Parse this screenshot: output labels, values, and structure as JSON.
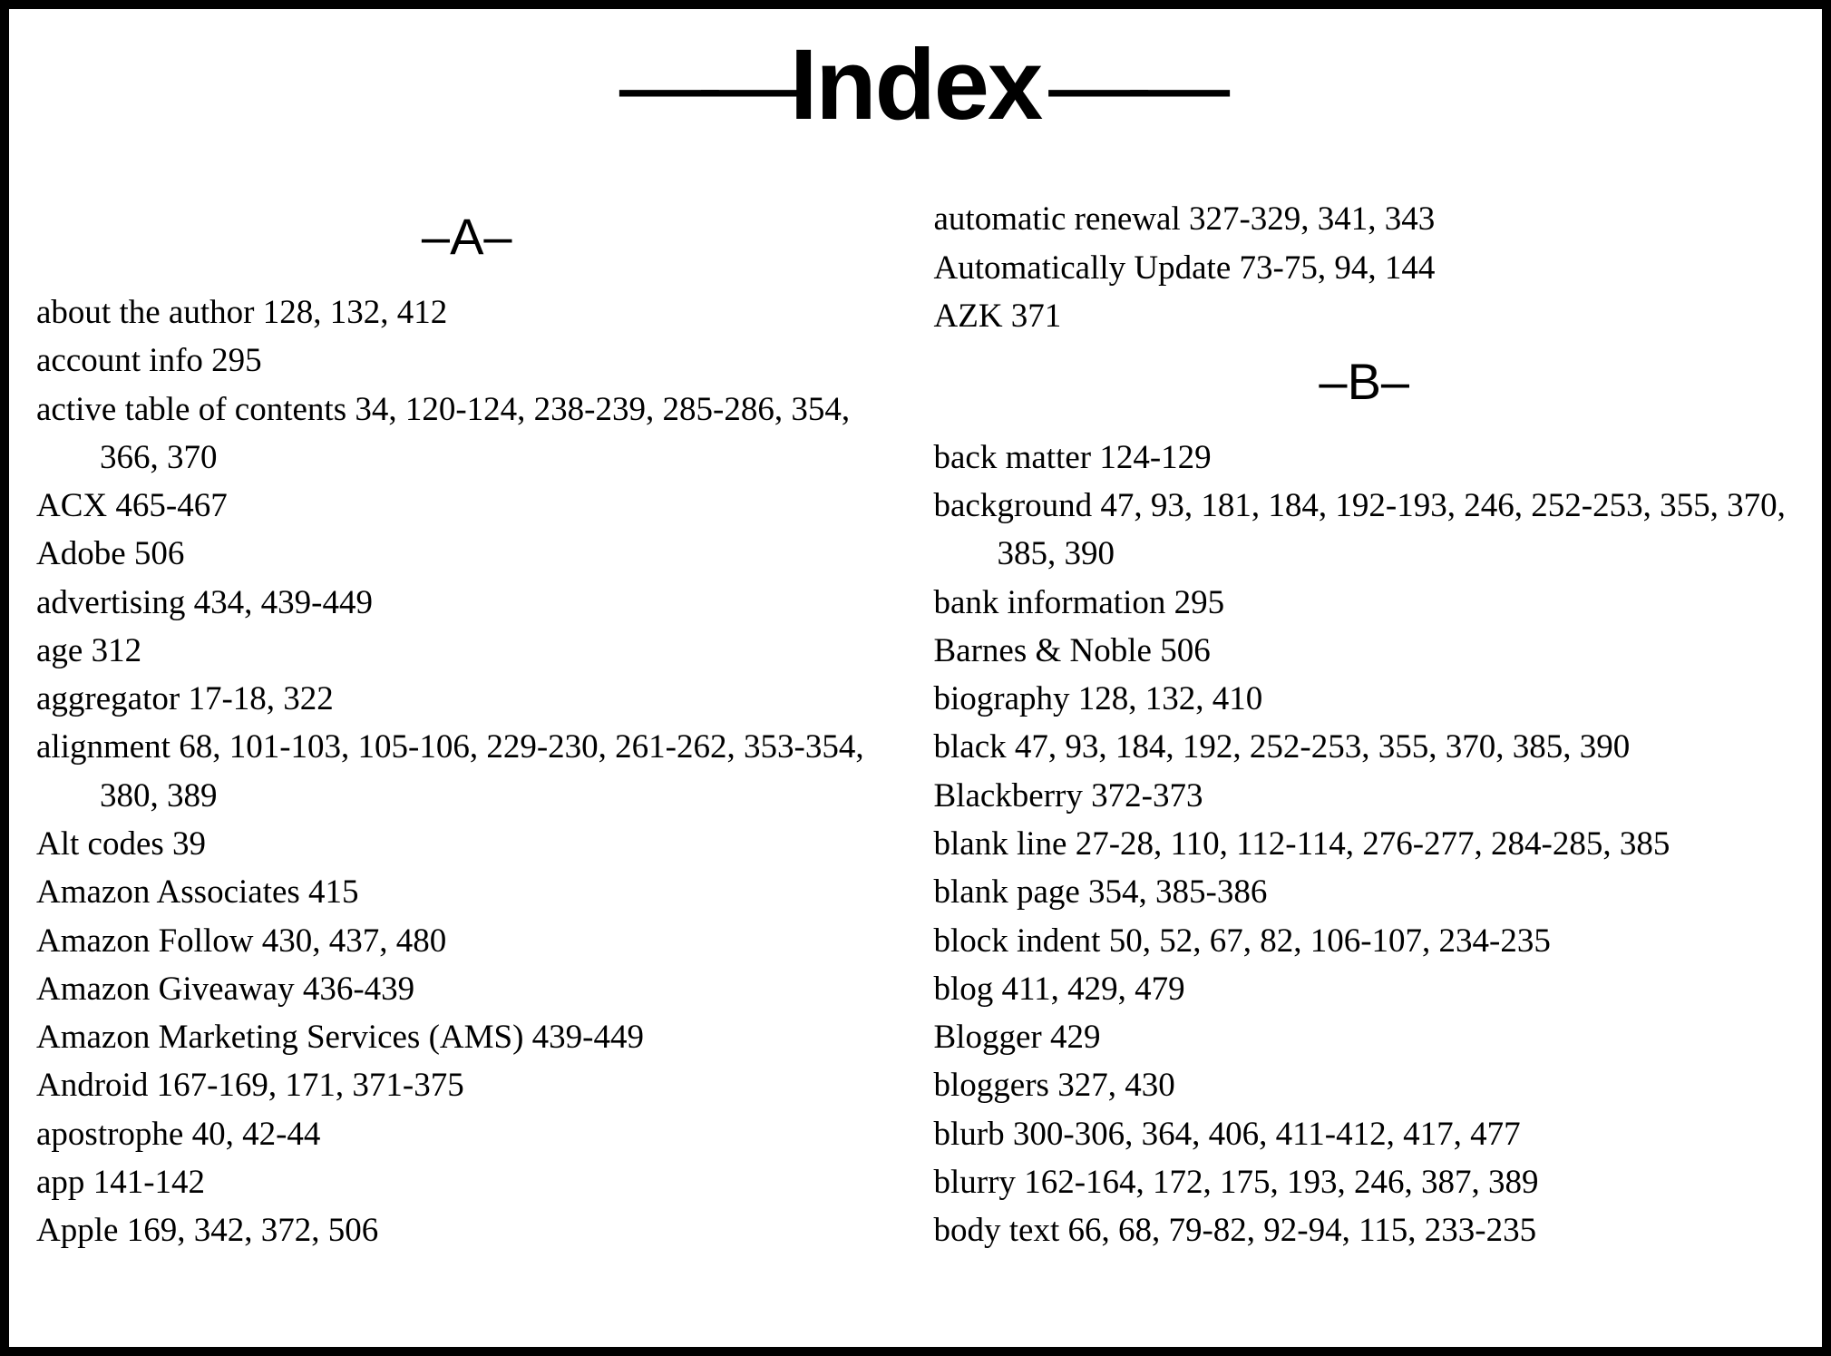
{
  "title": "Index",
  "sections": [
    {
      "letter": "A",
      "column": 0,
      "position": 0
    },
    {
      "letter": "B",
      "column": 1,
      "position": 3
    }
  ],
  "columns": [
    [
      {
        "term": "about the author",
        "pages": "128, 132, 412"
      },
      {
        "term": "account info",
        "pages": "295"
      },
      {
        "term": "active table of contents",
        "pages": "34, 120-124, 238-239, 285-286, 354, 366, 370"
      },
      {
        "term": "ACX",
        "pages": "465-467"
      },
      {
        "term": "Adobe",
        "pages": "506"
      },
      {
        "term": "advertising",
        "pages": "434, 439-449"
      },
      {
        "term": "age",
        "pages": "312"
      },
      {
        "term": "aggregator",
        "pages": "17-18, 322"
      },
      {
        "term": "alignment",
        "pages": "68, 101-103, 105-106, 229-230, 261-262, 353-354, 380, 389"
      },
      {
        "term": "Alt codes",
        "pages": "39"
      },
      {
        "term": "Amazon Associates",
        "pages": "415"
      },
      {
        "term": "Amazon Follow",
        "pages": "430, 437, 480"
      },
      {
        "term": "Amazon Giveaway",
        "pages": "436-439"
      },
      {
        "term": "Amazon Marketing Services (AMS)",
        "pages": "439-449"
      },
      {
        "term": "Android",
        "pages": "167-169, 171, 371-375"
      },
      {
        "term": "apostrophe",
        "pages": "40, 42-44"
      },
      {
        "term": "app",
        "pages": "141-142"
      },
      {
        "term": "Apple",
        "pages": "169, 342, 372, 506"
      }
    ],
    [
      {
        "term": "automatic renewal",
        "pages": "327-329, 341, 343"
      },
      {
        "term": "Automatically Update",
        "pages": "73-75, 94, 144"
      },
      {
        "term": "AZK",
        "pages": "371"
      },
      {
        "term": "back matter",
        "pages": "124-129"
      },
      {
        "term": "background",
        "pages": "47, 93, 181, 184, 192-193, 246, 252-253, 355, 370, 385, 390"
      },
      {
        "term": "bank information",
        "pages": "295"
      },
      {
        "term": "Barnes & Noble",
        "pages": "506"
      },
      {
        "term": "biography",
        "pages": "128, 132, 410"
      },
      {
        "term": "black",
        "pages": "47, 93, 184, 192, 252-253, 355, 370, 385, 390"
      },
      {
        "term": "Blackberry",
        "pages": "372-373"
      },
      {
        "term": "blank line",
        "pages": "27-28, 110, 112-114, 276-277, 284-285, 385"
      },
      {
        "term": "blank page",
        "pages": "354, 385-386"
      },
      {
        "term": "block indent",
        "pages": "50, 52, 67, 82, 106-107, 234-235"
      },
      {
        "term": "blog",
        "pages": "411, 429, 479"
      },
      {
        "term": "Blogger",
        "pages": "429"
      },
      {
        "term": "bloggers",
        "pages": "327, 430"
      },
      {
        "term": "blurb",
        "pages": "300-306, 364, 406, 411-412, 417, 477"
      },
      {
        "term": "blurry",
        "pages": "162-164, 172, 175, 193, 246, 387, 389"
      },
      {
        "term": "body text",
        "pages": "66, 68, 79-82, 92-94, 115, 233-235"
      }
    ]
  ]
}
